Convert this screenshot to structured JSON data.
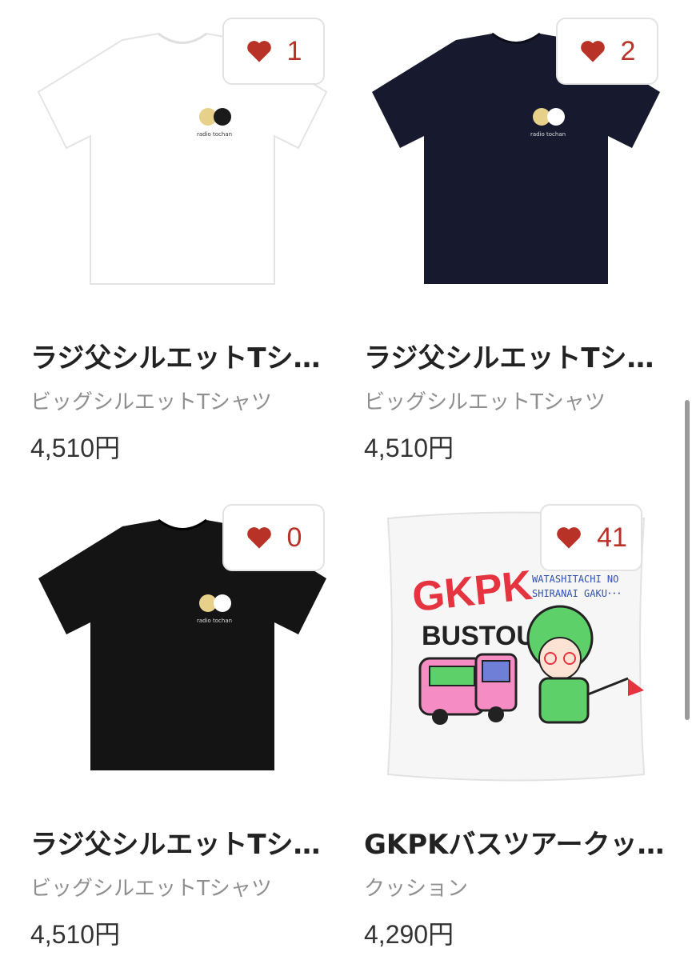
{
  "products": [
    {
      "title": "ラジ父シルエットTシャツ",
      "category": "ビッグシルエットTシャツ",
      "price": "4,510円",
      "likes": "1",
      "image": "tshirt-white",
      "color": "#ffffff"
    },
    {
      "title": "ラジ父シルエットTシャツ",
      "category": "ビッグシルエットTシャツ",
      "price": "4,510円",
      "likes": "2",
      "image": "tshirt-navy",
      "color": "#171a2e"
    },
    {
      "title": "ラジ父シルエットTシャツ",
      "category": "ビッグシルエットTシャツ",
      "price": "4,510円",
      "likes": "0",
      "image": "tshirt-black",
      "color": "#141414"
    },
    {
      "title": "GKPKバスツアークッション",
      "category": "クッション",
      "price": "4,290円",
      "likes": "41",
      "image": "cushion",
      "color": "#f4f4f4"
    }
  ],
  "print_text": "radio tochan",
  "cushion_art": {
    "logo": "GKPK",
    "tour": "BUSTOUR",
    "tagline_1": "WATASHITACHI NO",
    "tagline_2": "SHIRANAI GAKU･･･"
  },
  "colors": {
    "heart": "#b83227",
    "accent_red": "#e5333f",
    "green": "#5dd06a",
    "pink": "#f58dc4"
  }
}
